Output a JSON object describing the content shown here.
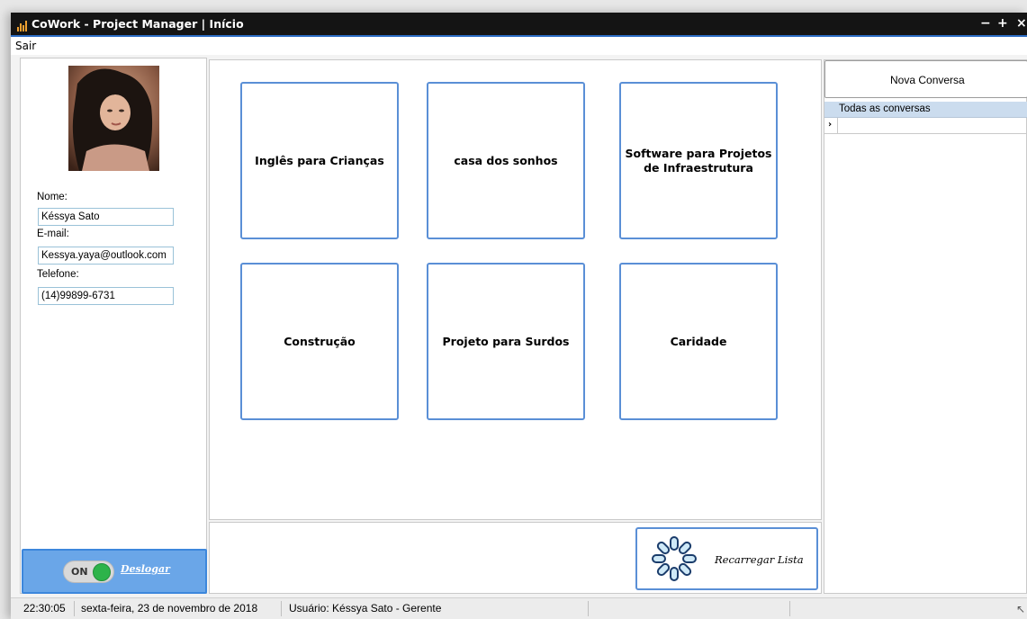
{
  "window": {
    "title": "CoWork - Project Manager | Início",
    "controls": {
      "minimize": "−",
      "maximize": "+",
      "close": "×"
    }
  },
  "menu": {
    "items": [
      {
        "label": "Sair"
      }
    ]
  },
  "profile": {
    "name_label": "Nome:",
    "name_value": "Késsya Sato",
    "email_label": "E-mail:",
    "email_value": "Kessya.yaya@outlook.com",
    "phone_label": "Telefone:",
    "phone_value": "(14)99899-6731"
  },
  "logout": {
    "toggle_text": "ON",
    "label": "Deslogar"
  },
  "projects": [
    {
      "title": "Inglês para Crianças"
    },
    {
      "title": "casa dos sonhos"
    },
    {
      "title": "Software para Projetos de Infraestrutura"
    },
    {
      "title": "Construção"
    },
    {
      "title": "Projeto para Surdos"
    },
    {
      "title": "Caridade"
    }
  ],
  "reload": {
    "label": "Recarregar Lista",
    "icon": "reload-spinner-icon"
  },
  "chat": {
    "new_button_label": "Nova Conversa",
    "grid_header": "Todas as conversas",
    "row_indicator": "›"
  },
  "status": {
    "time": "22:30:05",
    "date": "sexta-feira, 23 de novembro de 2018",
    "user": "Usuário: Késsya Sato - Gerente"
  },
  "colors": {
    "titlebar": "#141414",
    "accent": "#2b6cc4",
    "card_border": "#5a8fd6",
    "logout_bg": "#6aa6e8",
    "toggle_on": "#2db34a"
  }
}
